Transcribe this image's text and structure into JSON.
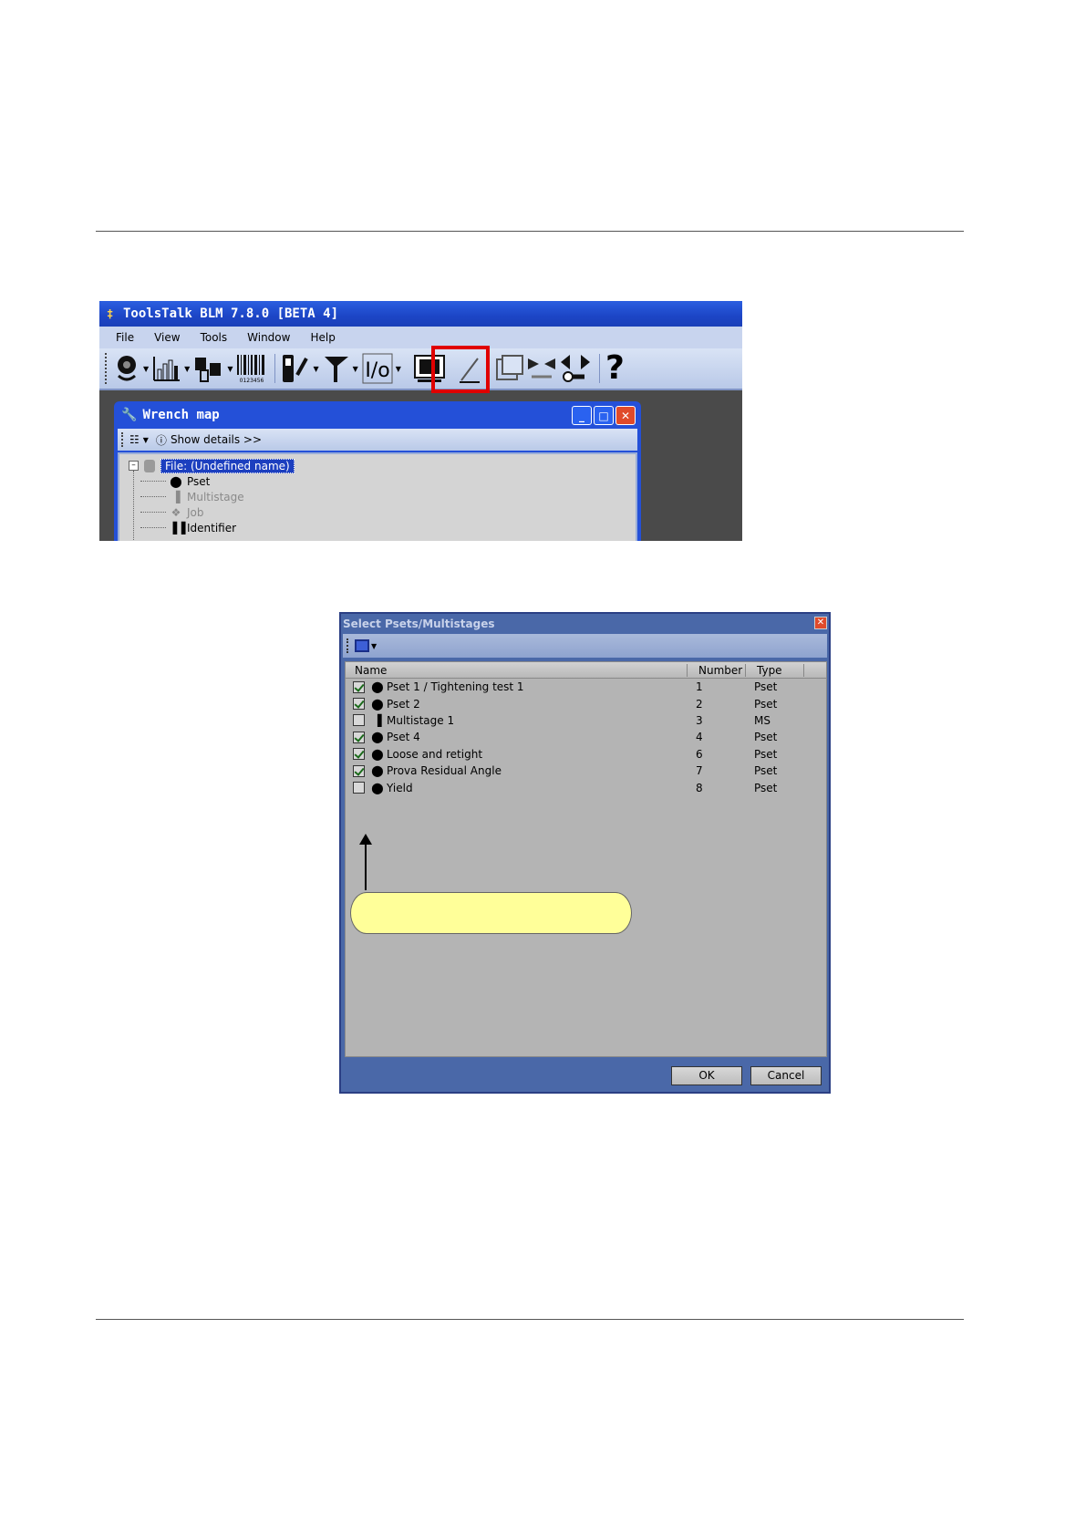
{
  "main_window": {
    "title": "ToolsTalk BLM 7.8.0 [BETA 4]",
    "menu": [
      "File",
      "View",
      "Tools",
      "Window",
      "Help"
    ],
    "toolbar_icons": [
      "pset-icon",
      "multistage-icon",
      "job-icon",
      "barcode-icon",
      "controller-icon",
      "tool-icon",
      "io-icon",
      "monitor-icon",
      "edit-icon",
      "folder-icon",
      "compare-icon",
      "connect-icon",
      "help-icon"
    ],
    "barcode_caption": "0123456",
    "io_label": "I/o",
    "help_glyph": "?",
    "highlight_color": "#e00000"
  },
  "wrench_map": {
    "title": "Wrench map",
    "show_details": "Show details >>",
    "tree": {
      "root": "File: (Undefined name)",
      "children": [
        {
          "label": "Pset",
          "enabled": true
        },
        {
          "label": "Multistage",
          "enabled": false
        },
        {
          "label": "Job",
          "enabled": false
        },
        {
          "label": "Identifier",
          "enabled": true
        }
      ]
    }
  },
  "select_dialog": {
    "title": "Select Psets/Multistages",
    "columns": [
      "Name",
      "Number",
      "Type"
    ],
    "rows": [
      {
        "checked": true,
        "name": "Pset 1 / Tightening test 1",
        "number": "1",
        "type": "Pset"
      },
      {
        "checked": true,
        "name": "Pset 2",
        "number": "2",
        "type": "Pset"
      },
      {
        "checked": false,
        "name": "Multistage 1",
        "number": "3",
        "type": "MS"
      },
      {
        "checked": true,
        "name": "Pset 4",
        "number": "4",
        "type": "Pset"
      },
      {
        "checked": true,
        "name": "Loose and retight",
        "number": "6",
        "type": "Pset"
      },
      {
        "checked": true,
        "name": "Prova Residual Angle",
        "number": "7",
        "type": "Pset"
      },
      {
        "checked": false,
        "name": "Yield",
        "number": "8",
        "type": "Pset"
      }
    ],
    "ok_label": "OK",
    "cancel_label": "Cancel",
    "callout_color": "#ffff99"
  }
}
